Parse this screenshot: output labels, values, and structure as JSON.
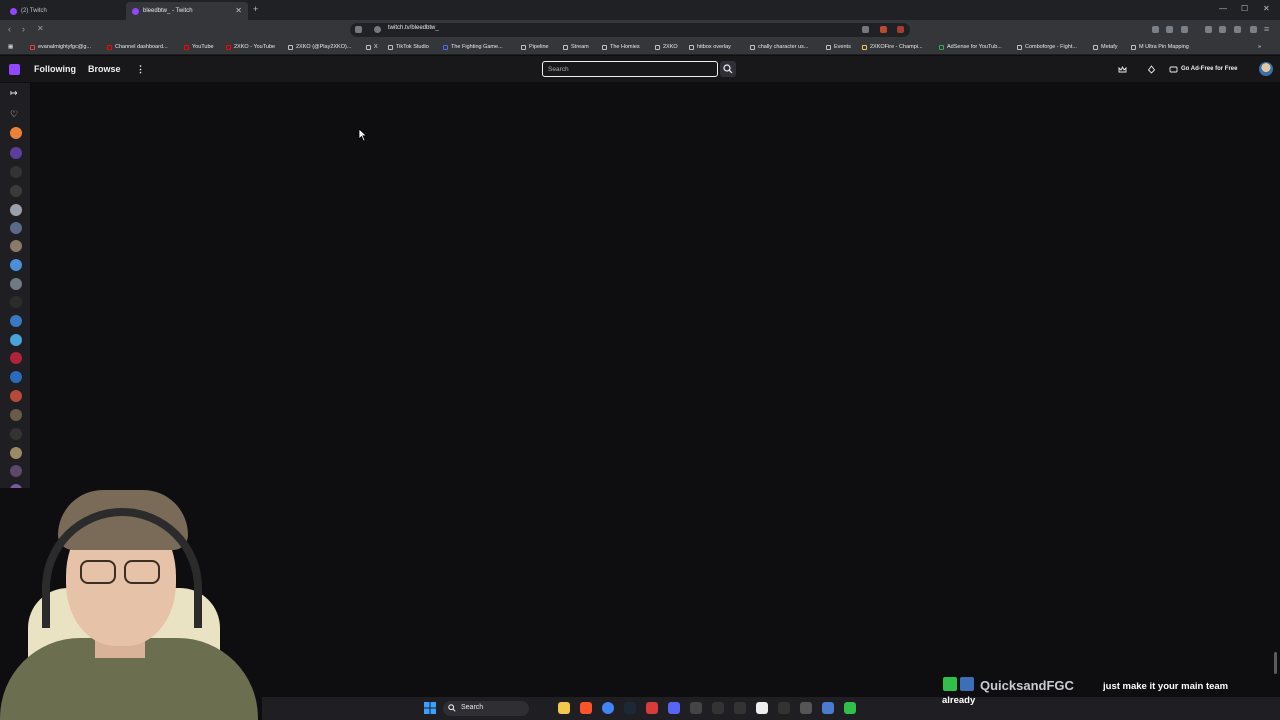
{
  "browser": {
    "tabs": [
      {
        "label": "(2) Twitch",
        "active": false
      },
      {
        "label": "bleedbtw_ - Twitch",
        "active": true
      }
    ],
    "url": "twitch.tv/bleedbtw_",
    "bookmarks": [
      "evanalmightyfgc@g...",
      "Channel dashboard...",
      "YouTube",
      "2XKO - YouTube",
      "2XKO (@Play2XKO)...",
      "X",
      "TikTok Studio",
      "The Fighting Game...",
      "Pipeline",
      "Stream",
      "The Homies",
      "2XKO",
      "hitbox overlay",
      "chally character us...",
      "Events",
      "2XKOFire - Champi...",
      "AdSense for YouTub...",
      "Comboforge - Fight...",
      "Metafy",
      "M Ultra Pin Mapping"
    ]
  },
  "twitch": {
    "nav": {
      "following": "Following",
      "browse": "Browse",
      "more": "⋮",
      "search_placeholder": "Search",
      "ad_free": "Go Ad-Free for Free"
    }
  },
  "chat_overlay": {
    "username": "QuicksandFGC",
    "message_line1": "just make it your main team",
    "message_line2": "already"
  },
  "taskbar": {
    "search_label": "Search"
  },
  "colors": {
    "twitch_purple": "#9147ff",
    "page_bg": "#0e0e10",
    "nav_bg": "#18181b"
  }
}
